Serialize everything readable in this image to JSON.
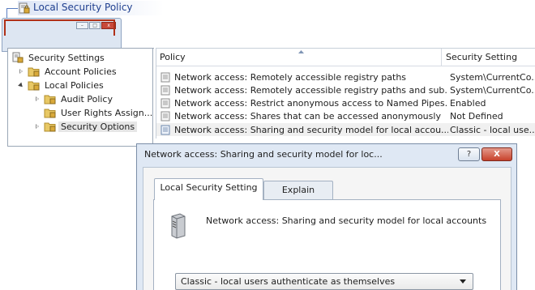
{
  "window": {
    "title": "Local Security Policy"
  },
  "tree": {
    "items": [
      {
        "label": "Security Settings",
        "expander": "none",
        "selected": false
      },
      {
        "label": "Account Policies",
        "expander": "collapsed",
        "selected": false
      },
      {
        "label": "Local Policies",
        "expander": "expanded",
        "selected": false
      },
      {
        "label": "Audit Policy",
        "expander": "collapsed",
        "selected": false
      },
      {
        "label": "User Rights Assign...",
        "expander": "none",
        "selected": false
      },
      {
        "label": "Security Options",
        "expander": "collapsed",
        "selected": true
      }
    ]
  },
  "list": {
    "columns": [
      "Policy",
      "Security Setting"
    ],
    "rows": [
      {
        "policy": "Network access: Remotely accessible registry paths",
        "setting": "System\\CurrentCo..."
      },
      {
        "policy": "Network access: Remotely accessible registry paths and sub...",
        "setting": "System\\CurrentCo..."
      },
      {
        "policy": "Network access: Restrict anonymous access to Named Pipes...",
        "setting": "Enabled"
      },
      {
        "policy": "Network access: Shares that can be accessed anonymously",
        "setting": "Not Defined"
      },
      {
        "policy": "Network access: Sharing and security model for local accou...",
        "setting": "Classic - local use..."
      }
    ],
    "selected_row": 4
  },
  "dialog": {
    "title": "Network access: Sharing and security model for loc...",
    "help_label": "?",
    "close_label": "X",
    "tabs": [
      "Local Security Setting",
      "Explain"
    ],
    "active_tab": 0,
    "setting_name": "Network access: Sharing and security model for local accounts",
    "selected_value": "Classic - local users authenticate as themselves"
  },
  "colors": {
    "title_text": "#1f3f8f",
    "dialog_frame": "#dfe8f4",
    "close_button": "#c7412b",
    "highlight_border": "#b03018"
  },
  "icons": {
    "policy": "policy-document-icon",
    "folder": "folder-lock-icon",
    "root": "security-settings-icon",
    "server": "server-icon"
  }
}
